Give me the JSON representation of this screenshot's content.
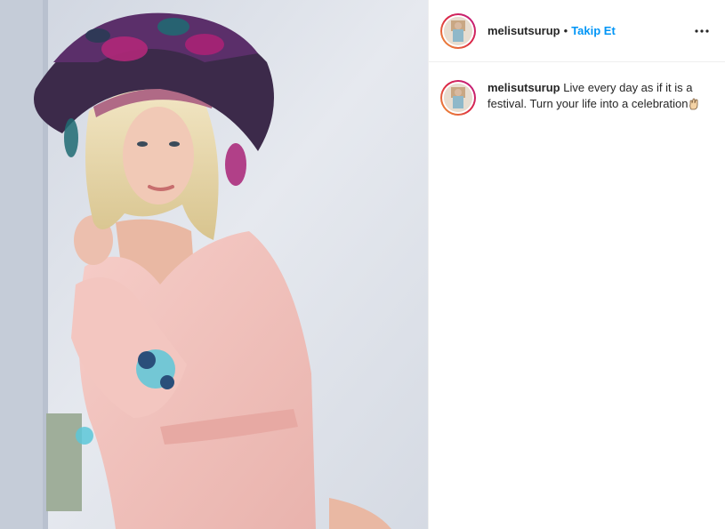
{
  "post": {
    "username": "melisutsurup",
    "separator": "•",
    "follow_label": "Takip Et",
    "more_icon": "more-options-icon",
    "caption": {
      "username": "melisutsurup",
      "text": "Live every day as if it is a festival. Turn your life into a celebration",
      "emoji_icon": "ok-hand-icon"
    }
  },
  "colors": {
    "follow_blue": "#0095f6",
    "text": "#262626",
    "divider": "#efefef"
  }
}
